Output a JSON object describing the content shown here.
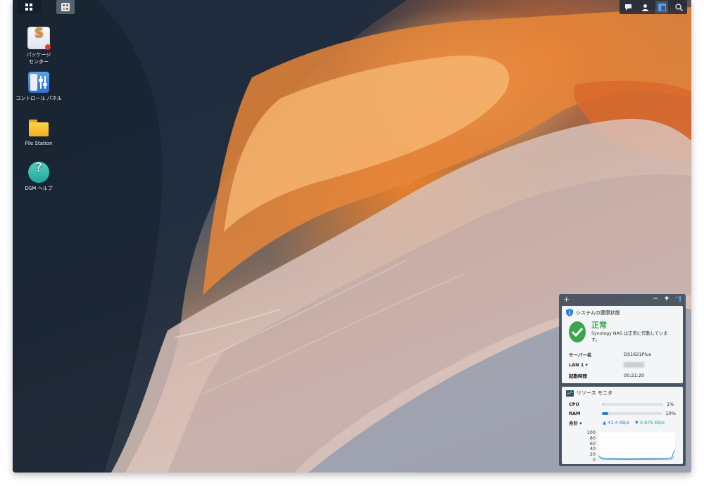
{
  "taskbar": {
    "icons": [
      "main-menu-icon",
      "app-window-icon"
    ],
    "right_icons": [
      "chat-icon",
      "user-icon",
      "widgets-icon",
      "search-icon"
    ]
  },
  "desktop_icons": [
    {
      "label": "パッケージ\nセンター",
      "icon": "package-center-icon"
    },
    {
      "label": "コントロール パネル",
      "icon": "control-panel-icon"
    },
    {
      "label": "File Station",
      "icon": "file-station-icon"
    },
    {
      "label": "DSM ヘルプ",
      "icon": "help-icon"
    }
  ],
  "widget": {
    "add_symbol": "+",
    "minimize_symbol": "−",
    "health": {
      "title": "システムの健康状態",
      "status": "正常",
      "status_desc": "Synology NAS は正常に作動しています。",
      "server_name_label": "サーバー名",
      "server_name": "DS1621Plus",
      "lan_label": "LAN 1",
      "lan_value": "███████",
      "uptime_label": "起動時間",
      "uptime": "00:21:20"
    },
    "resource": {
      "title": "リソース モニタ",
      "cpu_label": "CPU",
      "cpu_pct": 1,
      "cpu_text": "1%",
      "ram_label": "RAM",
      "ram_pct": 10,
      "ram_text": "10%",
      "total_label": "合計",
      "upload": "41.4 KB/s",
      "download": "0.876 KB/s",
      "chart_ticks": [
        "100",
        "80",
        "60",
        "40",
        "20",
        "0"
      ]
    }
  },
  "colors": {
    "accent": "#2f7fd6",
    "ok_green": "#3aa54a",
    "teal": "#2aa6a0"
  }
}
